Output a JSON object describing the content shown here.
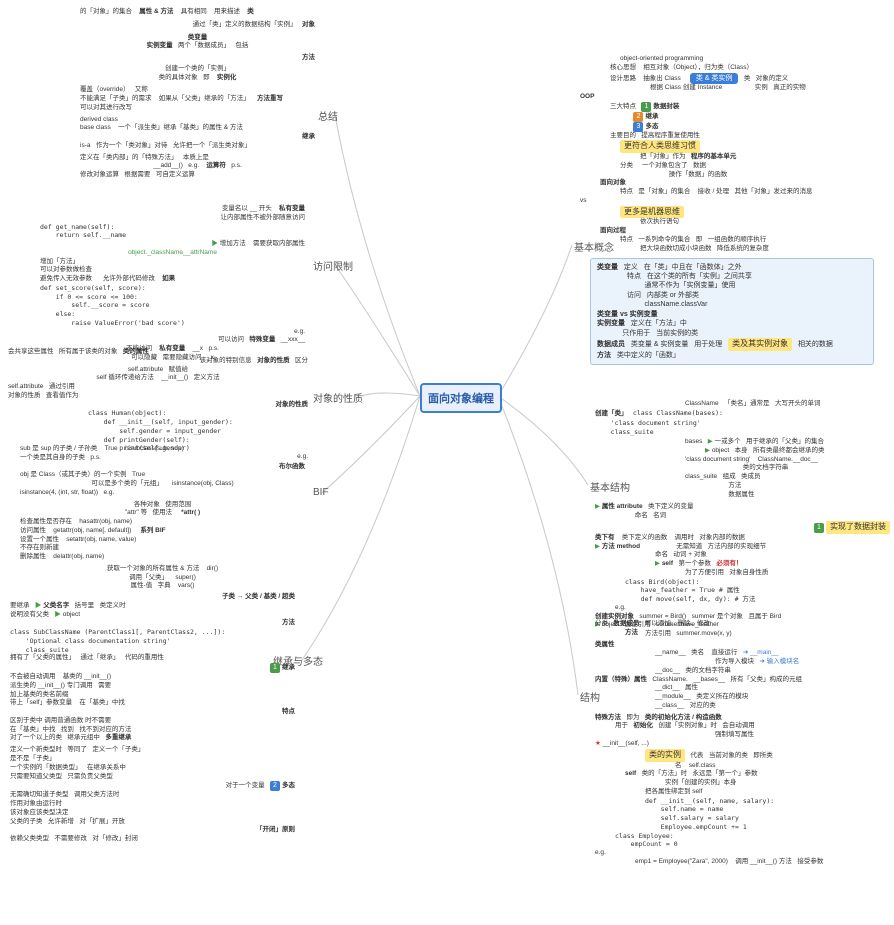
{
  "root": "面向对象编程",
  "main_branches": {
    "summary": "总结",
    "access": "访问限制",
    "properties": "对象的性质",
    "bif": "BIF",
    "inherit": "继承与多态",
    "basic": "基本概念",
    "selfstruct": "基本结构",
    "structure": "结构"
  },
  "summary": {
    "t1": "的「对象」的集合",
    "t2": "属性 & 方法",
    "t3": "具有相同",
    "t4": "用来描述",
    "cls": "类",
    "t5": "通过「类」定义的数据结构「实例」",
    "obj": "对象",
    "clsvar": "类变量",
    "instvar": "实例变量",
    "t6": "两个「数据成员」",
    "t7": "包括",
    "method": "方法",
    "inst": "实例化",
    "t8": "创建一个类的「实例」",
    "t9": "类的具体对象",
    "t10": "即",
    "override": "覆盖（override）",
    "t11": "又称",
    "rewrite": "方法重写",
    "t12": "不能满足「子类」的需求",
    "t13": "如果从「父类」继承的「方法」",
    "t14": "可以对其进行改写",
    "derived": "derived class",
    "base": "base class",
    "t15": "一个「派生类」继承「基类」的属性 & 方法",
    "inherit_lbl": "继承",
    "isa": "is-a",
    "t16": "作为一个「类对象」对待",
    "t17": "允许把一个「派生类对象」",
    "t18": "定义在「类内部」的「特殊方法」",
    "t19": "本质上是",
    "add": "__add__()",
    "eg": "e.g.",
    "calc": "运算符",
    "ps": "p.s.",
    "t20": "修改对象运算",
    "t21": "根据需要",
    "t22": "可自定义运算"
  },
  "access": {
    "priv": "私有变量",
    "t1": "变量名以 __ 开头",
    "t2": "让内部属性不被外部随意访问",
    "code1": "def get_name(self):\n    return self.__name",
    "addm": "增加方法",
    "t3": "需要获取内部属性",
    "green1": "object._className__attrName",
    "t4": "增加「方法」",
    "t5": "可以对参数做检查",
    "t6": "避免传入无效参数",
    "t7": "允许外部代码修改",
    "ifres": "如果",
    "code2": "def set_score(self, score):\n    if 0 <= score <= 100:\n        self.__score = score\n    else:\n        raise ValueError('bad score')",
    "eg": "e.g.",
    "special": "特殊变量",
    "xxx": "__xxx__",
    "t8": "可以访问",
    "t9": "不能访问",
    "privvar": "私有变量",
    "t10": "可以隐藏",
    "t11": "需要隐藏访问",
    "us": "__x",
    "sx": "_x",
    "ps": "p.s."
  },
  "properties": {
    "t1": "会共享这些属性",
    "t2": "所有属于该类的对象",
    "clsattr": "类的属性",
    "t3": "该对象的特别信息",
    "objattr": "对象的性质",
    "dist": "区分",
    "selfattr": "self.attribute",
    "t4": "赋值给",
    "init": "__init__()",
    "t5": "定义方法",
    "lookup": "查看值作为",
    "t6": "self 循环传递给方法",
    "t7": "通过引用",
    "sa": "self.attribute",
    "op": "对象的性质",
    "objprop": "对象的性质",
    "code": "class Human(object):\n    def __init__(self, input_gender):\n        self.gender = input_gender\n    def printGender(self):\n        print(self.gender)",
    "eg": "e.g."
  },
  "bif": {
    "t1": "sub 是 sup 的子类 / 子孙类",
    "true": "True",
    "issub": "issubclass(sub, sup)",
    "t2": "一个类是其自身的子类",
    "ps": "p.s.",
    "bool": "布尔函数",
    "t3": "obj 是 Class（或其子类）的一个实例",
    "isinst": "isinstance(obj, Class)",
    "t4": "可以是多个类的「元组」",
    "t5": "isinstance(4, (int, str, float))",
    "eg": "e.g.",
    "t6": "各种对象",
    "t7": "使用范围",
    "t8": "\"attr\" 等",
    "t9": "使用法",
    "attrfn": "*attr( )",
    "hasattr": "hasattr(obj, name)",
    "t10": "检查属性是否存在",
    "getattr": "getattr(obj, name[, default])",
    "t11": "访问属性",
    "seriesbif": "系列 BIF",
    "setattr": "setattr(obj, name, value)",
    "t12": "设置一个属性",
    "t13": "不存在则新建",
    "delattr": "delattr(obj, name)",
    "t14": "删除属性",
    "t15": "获取一个对象的所有属性 & 方法",
    "dir": "dir()",
    "t16": "调用「父类」",
    "super": "super()",
    "t17": "属性-值",
    "t18": "字典",
    "vars": "vars()"
  },
  "inherit": {
    "sub2parent": "子类 → 父类 / 基类 / 超类",
    "need": "要继承",
    "pname": "父类名字",
    "t1": "括号里",
    "t2": "类定义时",
    "t3": "说明没有父类",
    "obj": "object",
    "code": "class SubClassName (ParentClass1[, ParentClass2, ...]):\n    'Optional class documentation string'\n    class_suite",
    "method": "方法",
    "t4": "拥有了「父类的属性」",
    "t5": "通过「继承」",
    "t6": "代码的重用性",
    "inh": "继承",
    "t7": "不会被自动调用",
    "t8": "派生类的 __init__() 专门调用",
    "t9": "需要",
    "t10": "基类的 __init__()",
    "t11": "加上基类的类名前缀",
    "t12": "带上「self」参数变量",
    "feat": "特点",
    "t13": "区别于类中 调用普通函数 时不需要",
    "t14": "在「基类」中找",
    "t15": "找到",
    "t16": "找不到对应的方法",
    "t17": "对了一个以上的类",
    "t18": "继承元组中",
    "multi": "多重继承",
    "t19": "定义一个新类型时",
    "t20": "等同了",
    "t21": "定义一个「子类」",
    "t22": "是不是「子类」",
    "t23": "一个实例的「数据类型」",
    "t24": "只需要知道父类型",
    "t25": "无需确切知道子类型",
    "t26": "只需负责父类型",
    "t27": "在继承关系中",
    "opt": "对于一个变量",
    "poly": "多态",
    "t28": "调用父类方法时",
    "t29": "作用对象由运行时",
    "t30": "该对象应该类型决定",
    "t31": "父类的子类",
    "t32": "允许新增",
    "t33": "对「扩展」开放",
    "oc": "「开闭」原则",
    "t34": "依赖父类类型",
    "t35": "不需要修改",
    "t36": "对「修改」封闭"
  },
  "basic": {
    "oop": "object-oriented programming",
    "core": "核心思想",
    "t1": "相互对象（Object），归为类（Class）",
    "design": "设计思路",
    "abscls": "抽象出 Class",
    "mkinst": "根据 Class 创建 Instance",
    "clsinst": "类 & 类实例",
    "cls": "类",
    "t2": "对象的定义",
    "inst": "实例",
    "t3": "真正的实物",
    "ooplab": "OOP",
    "three": "三大特点",
    "enc": "数据封装",
    "inh": "继承",
    "poly": "多态",
    "goal": "主要目的",
    "t4": "提高程序重复使用性",
    "hl1": "更符合人类思维习惯",
    "objas": "把「对象」作为",
    "unit": "程序的基本单元",
    "cat": "分类",
    "t5": "一个对象包含了",
    "data": "数据",
    "t6": "操作「数据」的函数",
    "objorient": "面向对象",
    "feat": "特点",
    "t7": "是「对象」的集合",
    "t8": "接收 / 处理",
    "t9": "其他「对象」发过来的消息",
    "vs": "vs",
    "hl2": "更多是机器思维",
    "seq": "依次执行语句",
    "procorient": "面向过程",
    "t10": "一系列命令的集合",
    "ie": "即",
    "t11": "一组函数的顺序执行",
    "t12": "把大块函数切成小块函数",
    "t13": "降低系统的复杂度",
    "clsvar_vs": "类变量 vs 实例变量",
    "clsvar": "类变量",
    "def": "定义",
    "t14": "在「类」中且在「函数体」之外",
    "t15": "在这个类的所有「实例」之间共享",
    "t16": "通常不作为「实例变量」使用",
    "t17": "内部类 or 外部类",
    "visit": "访问",
    "t18": "className.classVar",
    "instvar": "实例变量",
    "t19": "定义在「方法」中",
    "t20": "只作用于",
    "t21": "当前实例的类",
    "datamem": "数据成员",
    "t22": "类变量 & 实例变量",
    "t23": "用于处理",
    "t24": "类及其实例对象",
    "t25": "相关的数据",
    "methoddef": "方法",
    "t26": "类中定义的「函数」"
  },
  "selfstruct": {
    "create": "创建「类」",
    "code1": "class ClassName(bases):\n    'class document string'\n    class_suite",
    "cn": "ClassName",
    "t1": "「类名」通常是",
    "t2": "大写开头的单词",
    "bases": "bases",
    "t3": "一或多个",
    "t4": "用于继承的「父类」的集合",
    "obj": "object",
    "t5": "本身",
    "t6": "所有类最终都会继承的类",
    "doc": "'class document string'",
    "t7": "ClassName.__doc__",
    "t8": "类的文档字符串",
    "suite": "class_suite",
    "t9": "组成",
    "t10": "类成员",
    "t11": "方法",
    "t12": "数据属性",
    "attr": "属性 attribute",
    "t13": "类下定义的变量",
    "name": "命名",
    "noun": "名词",
    "hl3": "实现了数据封装",
    "clshas": "类下有",
    "method": "方法 method",
    "t14": "类下定义的函数",
    "call": "调用时",
    "t15": "对象内部的数据",
    "t16": "无需知道",
    "t17": "方法内部的实现细节",
    "t18": "命名",
    "t19": "动词 + 对象",
    "self": "self",
    "t20": "第一个参数",
    "must": "必须有！",
    "t21": "为了方便引用",
    "t22": "对象自身性质",
    "code2": "class Bird(object):\n    have_feather = True # 属性\n    def move(self, dx, dy): # 方法",
    "eg": "e.g.",
    "createinst": "创建实例对象",
    "t23": "summer = Bird()",
    "t24": "方法引用",
    "t25": "summer 是个对象",
    "t26": "且属于 Bird",
    "objico": "object",
    "t27": "属性引用",
    "t28": "summer.have_feather",
    "t29": "方法引用",
    "t30": "summer.move(x, y)"
  },
  "structure": {
    "cat": "分类",
    "datamem": "数据成员",
    "t1": "可以添加、删除、修改",
    "method": "方法",
    "clsattr": "类属性",
    "name": "__name__",
    "t2": "类名",
    "t3": "直接运行",
    "main": "__main__",
    "t4": "作为导入模块",
    "t5": "输入模块名",
    "doc": "__doc__",
    "t6": "类的文档字符串",
    "builtin": "内置（特殊）属性",
    "cn": "ClassName.",
    "bases": "__bases__",
    "t7": "所有「父类」构成的元组",
    "dict": "__dict__",
    "t8": "属性",
    "module": "__module__",
    "t9": "类定义所在的模块",
    "cls": "__class__",
    "t10": "对应的类",
    "specm": "特殊方法",
    "aka": "即为",
    "t11": "类的初始化方法 / 构造函数",
    "usefor": "用于",
    "initlbl": "初始化",
    "t12": "创建「实例对象」时",
    "t13": "会自动调用",
    "t14": "强制填写属性",
    "init": "__init__(self, ...)",
    "hl4": "类的实例",
    "rep": "代表",
    "t15": "当前对象的类",
    "near": "即所类",
    "t16": "名",
    "selfcls": "self.class",
    "selflbl": "self",
    "t17": "类的「方法」时",
    "t18": "永远是「第一个」参数",
    "t19": "实例「创建的实例」本身",
    "t20": "把各属性绑定到 self",
    "code": "def __init__(self, name, salary):\n    self.name = name\n    self.salary = salary\n    Employee.empCount += 1",
    "empcls": "class Employee:\n    empCount = 0",
    "eg": "e.g.",
    "t21": "emp1 = Employee(\"Zara\", 2000)",
    "t22": "调用 __init__() 方法",
    "t23": "接受参数"
  }
}
